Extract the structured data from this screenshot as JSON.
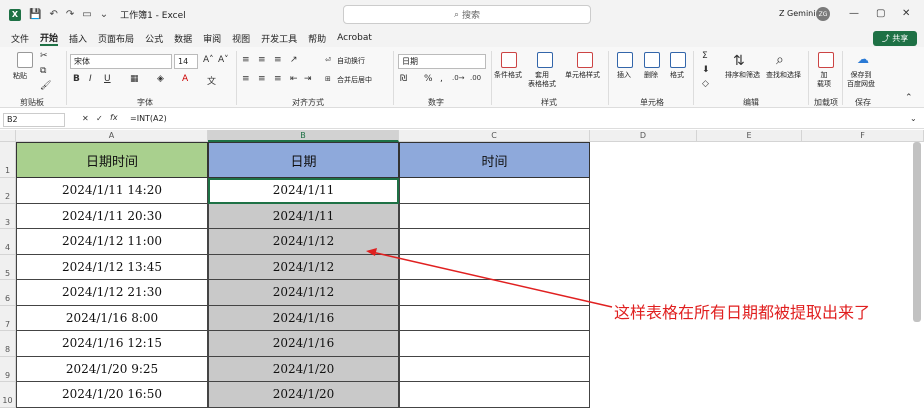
{
  "window": {
    "title": "工作簿1 - Excel",
    "user": "Z Gemini",
    "avatar_initials": "ZG",
    "search_placeholder": "搜索"
  },
  "menu": [
    "文件",
    "开始",
    "插入",
    "页面布局",
    "公式",
    "数据",
    "审阅",
    "视图",
    "开发工具",
    "帮助",
    "Acrobat"
  ],
  "share_label": "共享",
  "ribbon": {
    "paste": "粘贴",
    "clipboard": "剪贴板",
    "font_name": "宋体",
    "font_size": "14",
    "font_group": "字体",
    "wrap_text": "自动换行",
    "merge_center": "合并后居中",
    "alignment_group": "对齐方式",
    "number_format": "日期",
    "number_group": "数字",
    "cond_format": "条件格式",
    "table_format": "套用\n表格格式",
    "cell_style": "单元格样式",
    "styles_group": "样式",
    "insert": "插入",
    "delete": "删除",
    "format": "格式",
    "cells_group": "单元格",
    "sort_filter": "排序和筛选",
    "find_select": "查找和选择",
    "editing_group": "编辑",
    "addins": "加\n载项",
    "addins_group": "加载项",
    "save_baidu": "保存到\n百度网盘",
    "save_group": "保存"
  },
  "formula_bar": {
    "name_box": "B2",
    "fx": "fx",
    "formula": "=INT(A2)"
  },
  "columns": [
    "A",
    "B",
    "C",
    "D",
    "E",
    "F"
  ],
  "rows": [
    "1",
    "2",
    "3",
    "4",
    "5",
    "6",
    "7",
    "8",
    "9",
    "10"
  ],
  "table": {
    "headers": [
      "日期时间",
      "日期",
      "时间"
    ],
    "datetime": [
      "2024/1/11 14:20",
      "2024/1/11 20:30",
      "2024/1/12 11:00",
      "2024/1/12 13:45",
      "2024/1/12 21:30",
      "2024/1/16 8:00",
      "2024/1/16 12:15",
      "2024/1/20 9:25",
      "2024/1/20 16:50"
    ],
    "date": [
      "2024/1/11",
      "2024/1/11",
      "2024/1/12",
      "2024/1/12",
      "2024/1/12",
      "2024/1/16",
      "2024/1/16",
      "2024/1/20",
      "2024/1/20"
    ]
  },
  "annotation": "这样表格在所有日期都被提取出来了",
  "colors": {
    "excel_green": "#1e7145",
    "header_green": "#a9d08e",
    "header_blue": "#8ea9db",
    "selection_gray": "#c9c9c9",
    "annotation_red": "#e02020"
  }
}
